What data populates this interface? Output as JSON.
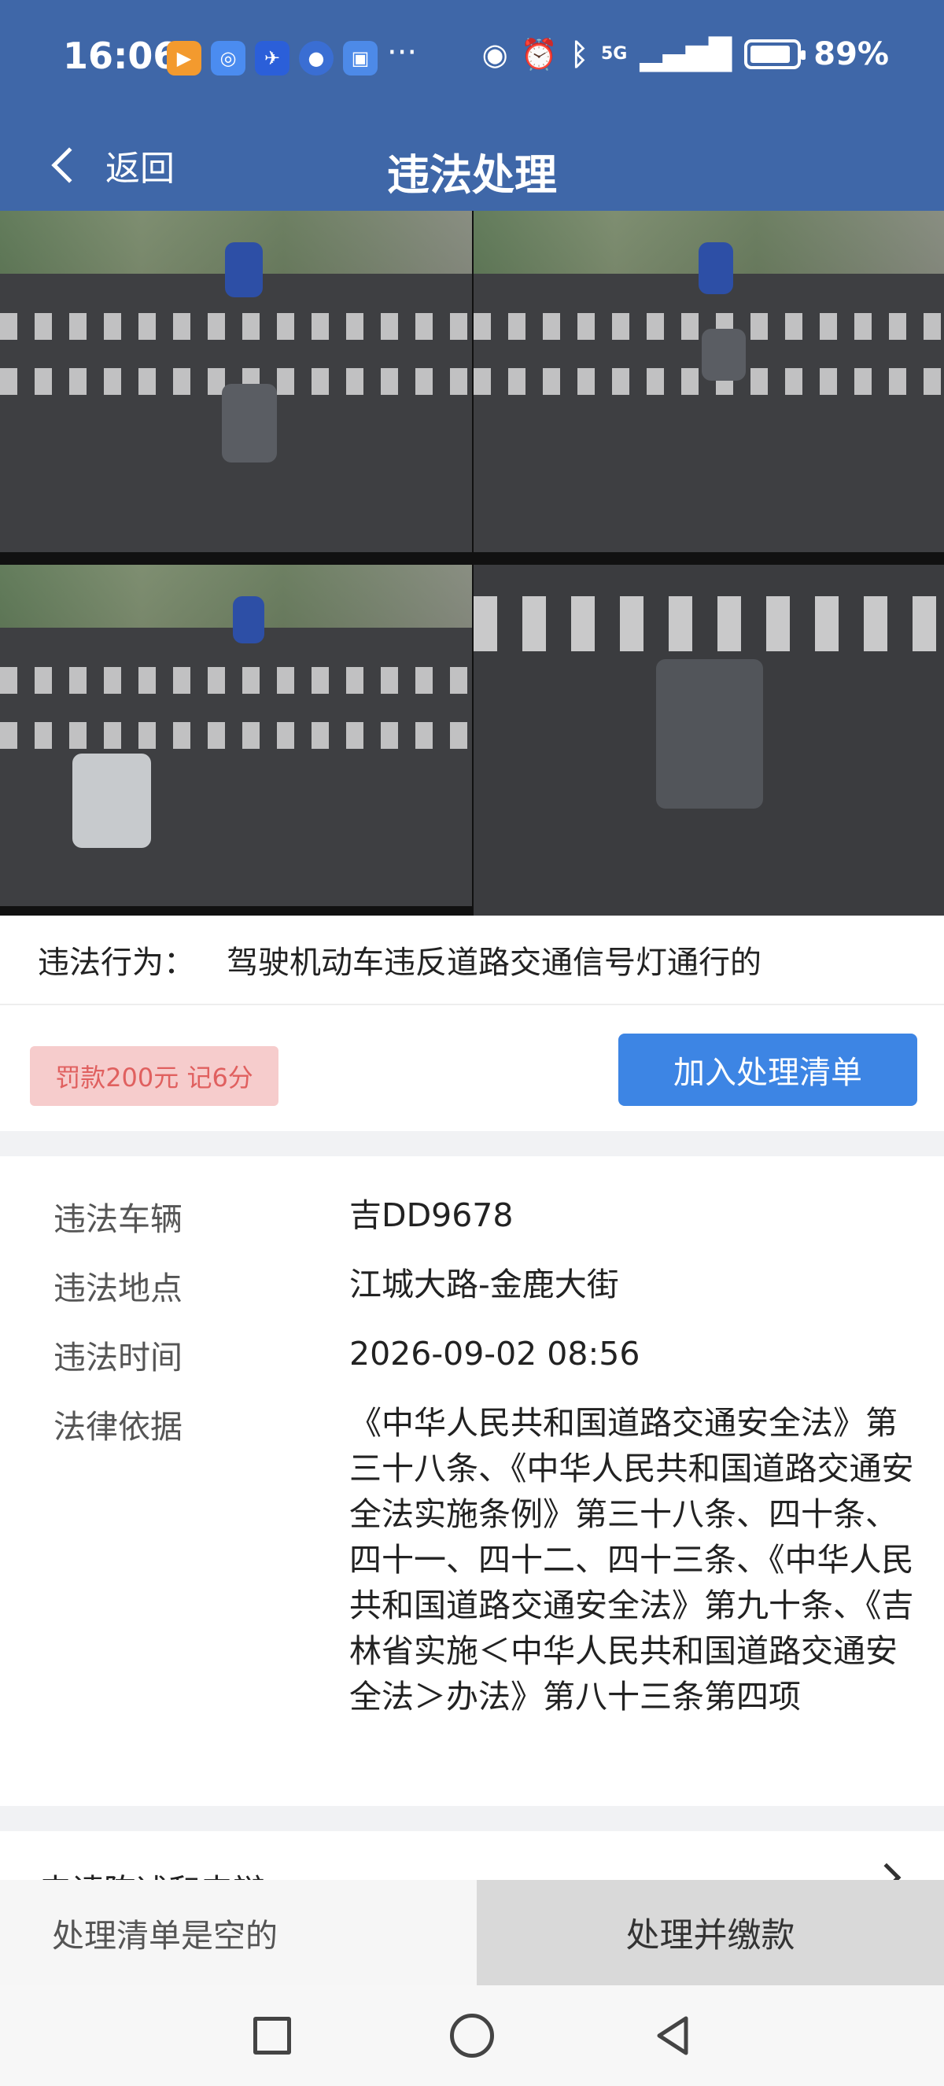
{
  "status_bar": {
    "time": "16:06",
    "more": "···",
    "network": "5G",
    "battery": "89%",
    "battery_level": 0.89
  },
  "nav": {
    "back_label": "返回",
    "title": "违法处理"
  },
  "violation": {
    "behavior_label": "违法行为：",
    "behavior_value": "驾驶机动车违反道路交通信号灯通行的",
    "fine_badge": "罚款200元 记6分",
    "add_list_button": "加入处理清单"
  },
  "details": {
    "vehicle_label": "违法车辆",
    "vehicle_value": "吉DD9678",
    "location_label": "违法地点",
    "location_value": "江城大路-金鹿大街",
    "time_label": "违法时间",
    "time_value": "2026-09-02 08:56",
    "basis_label": "法律依据",
    "basis_value": "《中华人民共和国道路交通安全法》第三十八条、《中华人民共和国道路交通安全法实施条例》第三十八条、四十条、四十一、四十二、四十三条、《中华人民共和国道路交通安全法》第九十条、《吉林省实施＜中华人民共和国道路交通安全法＞办法》第八十三条第四项"
  },
  "appeal": {
    "label": "申请陈述和申辩"
  },
  "bottom_bar": {
    "list_status": "处理清单是空的",
    "pay_button": "处理并缴款"
  },
  "colors": {
    "header": "#3f67a8",
    "primary_button": "#3d85e4",
    "fine_badge_bg": "#f6cccc",
    "fine_badge_text": "#e0605f"
  }
}
